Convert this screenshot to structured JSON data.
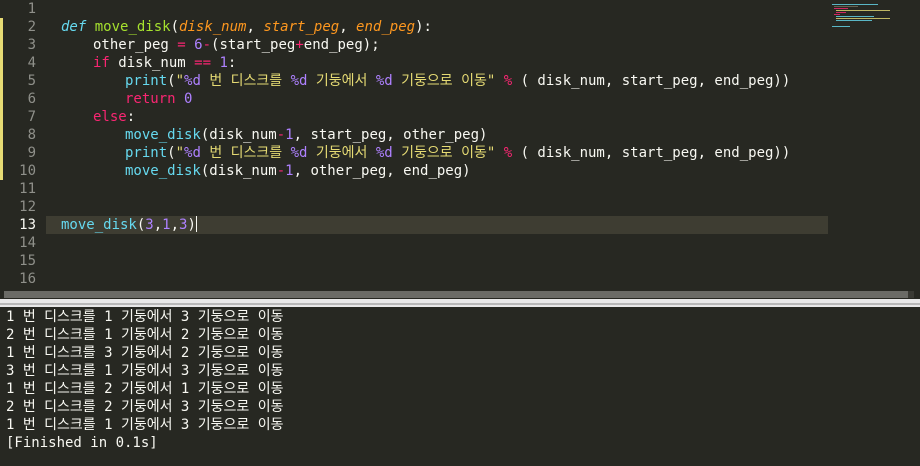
{
  "editor": {
    "line_numbers": [
      "1",
      "2",
      "3",
      "4",
      "5",
      "6",
      "7",
      "8",
      "9",
      "10",
      "11",
      "12",
      "13",
      "14",
      "15",
      "16"
    ],
    "current_line": "13",
    "code": {
      "l2": {
        "kw": "def",
        "name": "move_disk",
        "open": "(",
        "p1": "disk_num",
        "c1": ", ",
        "p2": "start_peg",
        "c2": ", ",
        "p3": "end_peg",
        "close": "):"
      },
      "l3": {
        "a": "other_peg ",
        "eq": "=",
        "sp": " ",
        "six": "6",
        "minus": "-",
        "rest": "(start_peg",
        "plus": "+",
        "end": "end_peg);"
      },
      "l4": {
        "kw": "if",
        "a": " disk_num ",
        "op": "==",
        "sp": " ",
        "one": "1",
        "colon": ":"
      },
      "print_line": {
        "fn": "print",
        "open": "(",
        "q1": "\"",
        "f1": "%d",
        "s1": " 번 디스크를 ",
        "f2": "%d",
        "s2": " 기둥에서 ",
        "f3": "%d",
        "s3": " 기둥으로 이동\"",
        "sp": " ",
        "pct": "%",
        "args": " ( disk_num, start_peg, end_peg))"
      },
      "l6": {
        "kw": "return",
        "sp": " ",
        "zero": "0"
      },
      "l7": {
        "kw": "else",
        "colon": ":"
      },
      "l8": {
        "fn": "move_disk",
        "a": "(disk_num",
        "minus": "-",
        "one": "1",
        "b": ", start_peg, other_peg)"
      },
      "l10": {
        "fn": "move_disk",
        "a": "(disk_num",
        "minus": "-",
        "one": "1",
        "b": ", other_peg, end_peg)"
      },
      "l13": {
        "fn": "move_disk",
        "a": "(",
        "n1": "3",
        "c1": ",",
        "n2": "1",
        "c2": ",",
        "n3": "3",
        "b": ")"
      }
    }
  },
  "output": {
    "lines": [
      "1 번 디스크를 1 기둥에서 3 기둥으로 이동",
      "2 번 디스크를 1 기둥에서 2 기둥으로 이동",
      "1 번 디스크를 3 기둥에서 2 기둥으로 이동",
      "3 번 디스크를 1 기둥에서 3 기둥으로 이동",
      "1 번 디스크를 2 기둥에서 1 기둥으로 이동",
      "2 번 디스크를 2 기둥에서 3 기둥으로 이동",
      "1 번 디스크를 1 기둥에서 3 기둥으로 이동",
      "[Finished in 0.1s]"
    ]
  },
  "colors": {
    "background": "#272822",
    "keyword": "#f92672",
    "function": "#a6e22e",
    "parameter": "#fd971f",
    "number": "#ae81ff",
    "string": "#e6db74",
    "builtin": "#66d9ef",
    "text": "#f8f8f2"
  }
}
